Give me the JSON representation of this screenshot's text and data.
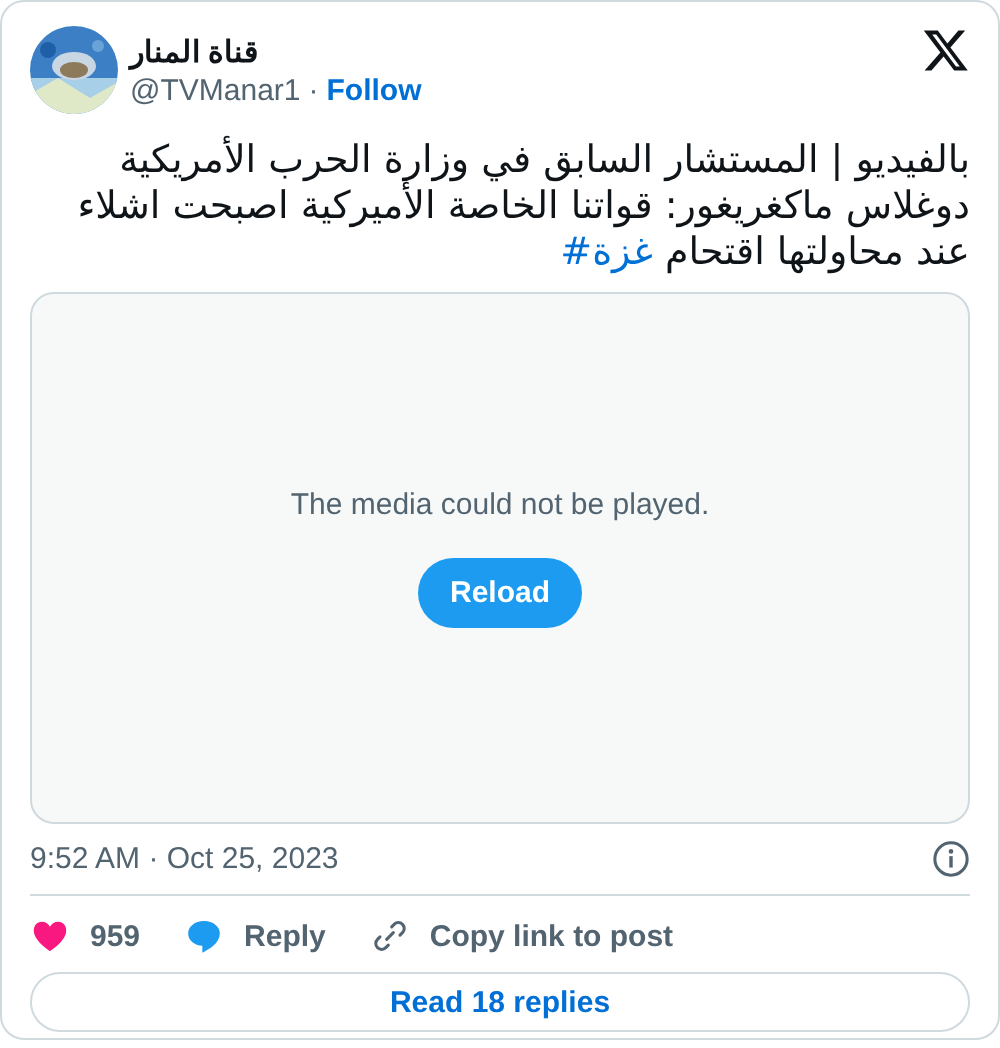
{
  "author": {
    "name": "قناة المنار",
    "handle": "@TVManar1",
    "separator": "·",
    "follow": "Follow"
  },
  "post": {
    "text": "بالفيديو | المستشار السابق في وزارة الحرب الأمريكية دوغلاس ماكغريغور: قواتنا الخاصة الأميركية اصبحت اشلاء عند محاولتها اقتحام",
    "hashtag": "#غزة"
  },
  "media": {
    "message": "The media could not be played.",
    "button": "Reload"
  },
  "timestamp": "9:52 AM · Oct 25, 2023",
  "actions": {
    "likes": "959",
    "reply": "Reply",
    "copy": "Copy link to post"
  },
  "read_replies": "Read 18 replies"
}
